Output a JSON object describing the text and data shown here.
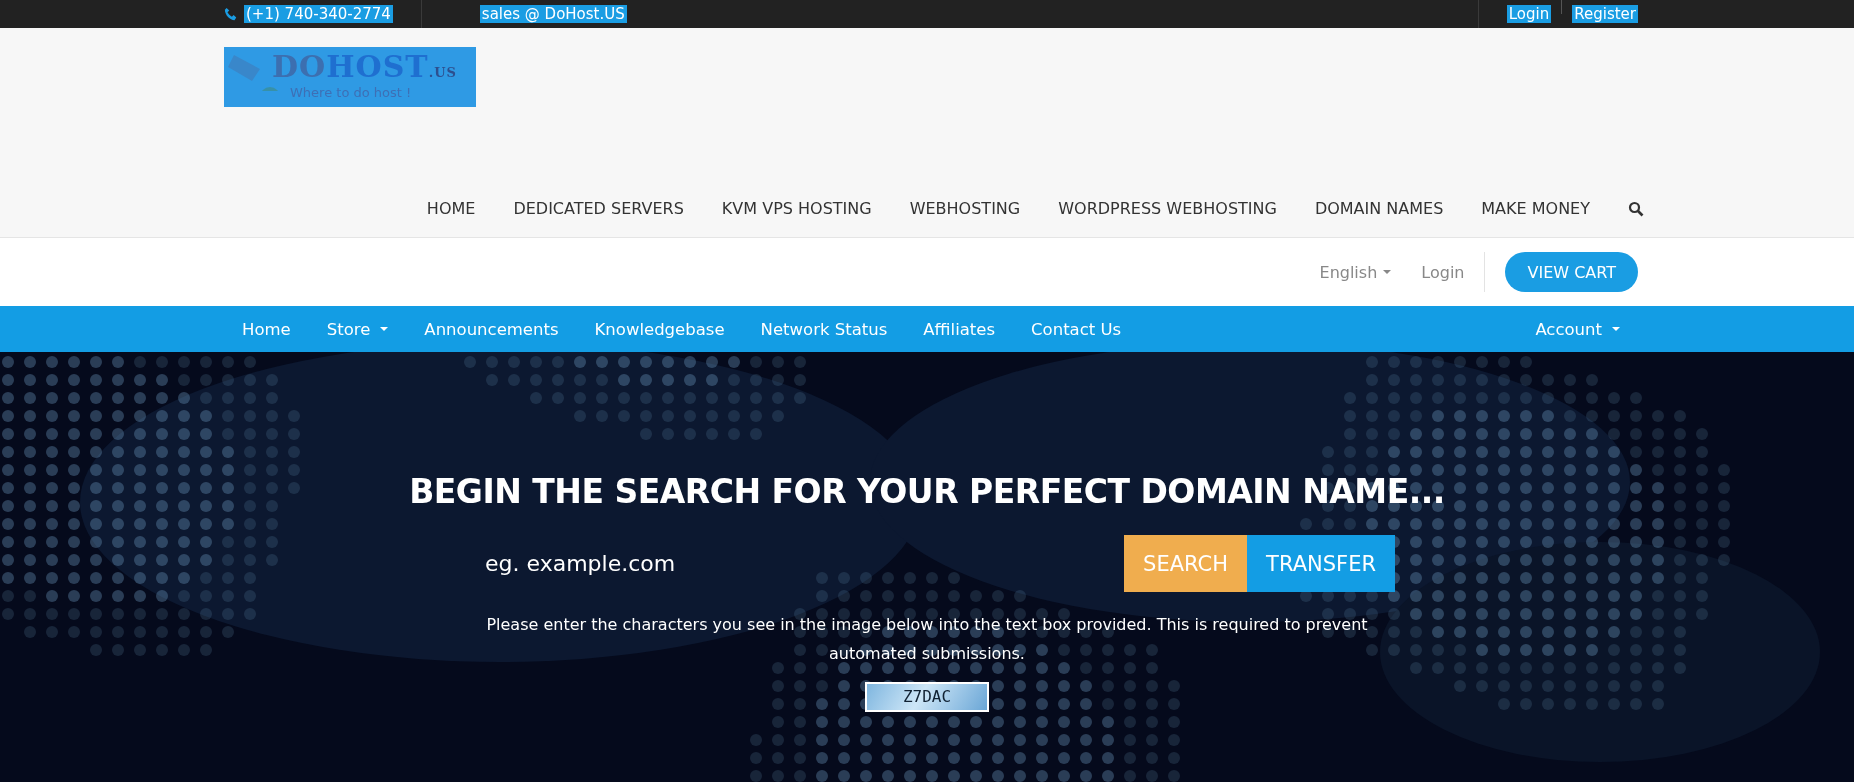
{
  "top_bar": {
    "phone": "(+1) 740-340-2774",
    "email": "sales @ DoHost.US",
    "links": [
      "Login",
      "Register"
    ]
  },
  "logo": {
    "name_dark": "DO",
    "name_light": "HOST",
    "suffix": ".US",
    "tagline": "Where to do host !"
  },
  "main_nav": {
    "items": [
      "HOME",
      "DEDICATED SERVERS",
      "KVM VPS HOSTING",
      "WEBHOSTING",
      "WORDPRESS WEBHOSTING",
      "DOMAIN NAMES",
      "MAKE MONEY"
    ]
  },
  "utility_bar": {
    "language": "English",
    "login": "Login",
    "cart_button": "VIEW CART"
  },
  "client_nav": {
    "items": [
      {
        "label": "Home",
        "dropdown": false
      },
      {
        "label": "Store",
        "dropdown": true
      },
      {
        "label": "Announcements",
        "dropdown": false
      },
      {
        "label": "Knowledgebase",
        "dropdown": false
      },
      {
        "label": "Network Status",
        "dropdown": false
      },
      {
        "label": "Affiliates",
        "dropdown": false
      },
      {
        "label": "Contact Us",
        "dropdown": false
      }
    ],
    "account": {
      "label": "Account",
      "dropdown": true
    }
  },
  "hero": {
    "title": "BEGIN THE SEARCH FOR YOUR PERFECT DOMAIN NAME...",
    "search": {
      "placeholder": "eg. example.com"
    },
    "buttons": [
      {
        "label": "SEARCH",
        "kind": "search"
      },
      {
        "label": "TRANSFER",
        "kind": "transfer"
      }
    ],
    "notice": "Please enter the characters you see in the image below into the text box provided. This is required to prevent automated submissions.",
    "captcha": "Z7DAC"
  }
}
